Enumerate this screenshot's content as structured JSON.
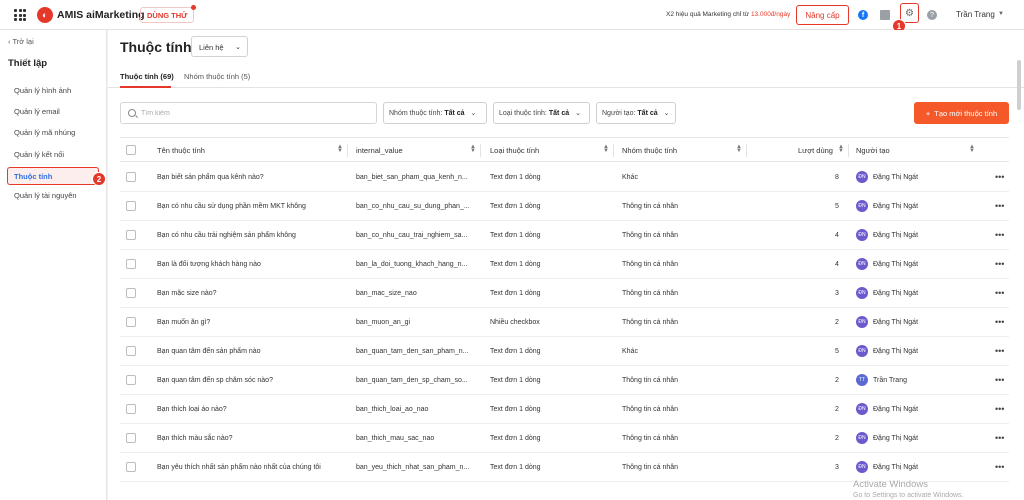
{
  "topbar": {
    "logo_letter": "◐",
    "brand": "AMIS aiMarketing",
    "trial_label": "DÙNG THỬ",
    "promo_text": "X2 hiệu quả Marketing chỉ từ ",
    "promo_price": "13.000đ/ngày",
    "upgrade_label": "Nâng cấp",
    "user_name": "Trần Trang",
    "icons": [
      "grid-menu-icon",
      "facebook-icon",
      "box-icon",
      "settings-icon",
      "help-icon",
      "caret-down-icon"
    ],
    "marker_settings": "1"
  },
  "sidebar": {
    "back_label": "Trở lại",
    "section_title": "Thiết lập",
    "items": [
      {
        "label": "Quản lý hình ảnh"
      },
      {
        "label": "Quản lý email"
      },
      {
        "label": "Quản lý mã nhúng"
      },
      {
        "label": "Quản lý kết nối"
      },
      {
        "label": "Thuộc tính"
      },
      {
        "label": "Quản lý tài nguyên"
      }
    ],
    "marker_active": "2"
  },
  "main": {
    "title": "Thuộc tính",
    "title_select": "Liên hệ",
    "tabs": [
      {
        "label": "Thuộc tính (69)"
      },
      {
        "label": "Nhóm thuộc tính (5)"
      }
    ],
    "search_placeholder": "Tìm kiếm",
    "filters": [
      {
        "prefix": "Nhóm thuộc tính:",
        "value": "Tất cả"
      },
      {
        "prefix": "Loại thuộc tính:",
        "value": "Tất cả"
      },
      {
        "prefix": "Người tạo:",
        "value": "Tất cả"
      }
    ],
    "create_label": "Tạo mới thuộc tính"
  },
  "table": {
    "columns": [
      "Tên thuộc tính",
      "internal_value",
      "Loại thuộc tính",
      "Nhóm thuộc tính",
      "Lượt dùng",
      "Người tạo"
    ],
    "rows": [
      {
        "name": "Bạn biết sản phẩm qua kênh nào?",
        "internal": "ban_biet_san_pham_qua_kenh_n...",
        "type": "Text đơn 1 dòng",
        "group": "Khác",
        "uses": "8",
        "initials": "ĐN",
        "creator": "Đặng Thị Ngát"
      },
      {
        "name": "Bạn có nhu cầu sử dụng phần mềm MKT không",
        "internal": "ban_co_nhu_cau_su_dung_phan_...",
        "type": "Text đơn 1 dòng",
        "group": "Thông tin cá nhân",
        "uses": "5",
        "initials": "ĐN",
        "creator": "Đặng Thị Ngát"
      },
      {
        "name": "Bạn có nhu cầu trải nghiệm sản phẩm không",
        "internal": "ban_co_nhu_cau_trai_nghiem_sa...",
        "type": "Text đơn 1 dòng",
        "group": "Thông tin cá nhân",
        "uses": "4",
        "initials": "ĐN",
        "creator": "Đặng Thị Ngát"
      },
      {
        "name": "Bạn là đối tượng khách hàng nào",
        "internal": "ban_la_doi_tuong_khach_hang_n...",
        "type": "Text đơn 1 dòng",
        "group": "Thông tin cá nhân",
        "uses": "4",
        "initials": "ĐN",
        "creator": "Đặng Thị Ngát"
      },
      {
        "name": "Bạn mặc size nào?",
        "internal": "ban_mac_size_nao",
        "type": "Text đơn 1 dòng",
        "group": "Thông tin cá nhân",
        "uses": "3",
        "initials": "ĐN",
        "creator": "Đặng Thị Ngát"
      },
      {
        "name": "Bạn muốn ăn gì?",
        "internal": "ban_muon_an_gi",
        "type": "Nhiều checkbox",
        "group": "Thông tin cá nhân",
        "uses": "2",
        "initials": "ĐN",
        "creator": "Đặng Thị Ngát"
      },
      {
        "name": "Bạn quan tâm đến sản phẩm nào",
        "internal": "ban_quan_tam_den_san_pham_n...",
        "type": "Text đơn 1 dòng",
        "group": "Khác",
        "uses": "5",
        "initials": "ĐN",
        "creator": "Đặng Thị Ngát"
      },
      {
        "name": "Bạn quan tâm đến sp chăm sóc nào?",
        "internal": "ban_quan_tam_den_sp_cham_so...",
        "type": "Text đơn 1 dòng",
        "group": "Thông tin cá nhân",
        "uses": "2",
        "initials": "TT",
        "creator": "Trần Trang"
      },
      {
        "name": "Bạn thích loại áo nào?",
        "internal": "ban_thich_loai_ao_nao",
        "type": "Text đơn 1 dòng",
        "group": "Thông tin cá nhân",
        "uses": "2",
        "initials": "ĐN",
        "creator": "Đặng Thị Ngát"
      },
      {
        "name": "Bạn thích màu sắc nào?",
        "internal": "ban_thich_mau_sac_nao",
        "type": "Text đơn 1 dòng",
        "group": "Thông tin cá nhân",
        "uses": "2",
        "initials": "ĐN",
        "creator": "Đặng Thị Ngát"
      },
      {
        "name": "Bạn yêu thích nhất sản phẩm nào nhất của chúng tôi",
        "internal": "ban_yeu_thich_nhat_san_pham_n...",
        "type": "Text đơn 1 dòng",
        "group": "Thông tin cá nhân",
        "uses": "3",
        "initials": "ĐN",
        "creator": "Đặng Thị Ngát"
      }
    ],
    "row_action": "•••"
  },
  "watermark": {
    "line1": "Activate Windows",
    "line2": "Go to Settings to activate Windows."
  },
  "colors": {
    "accent": "#e5372a",
    "create_button": "#f5592a",
    "link": "#2f6fe0",
    "avatar": "#6a5acd"
  }
}
